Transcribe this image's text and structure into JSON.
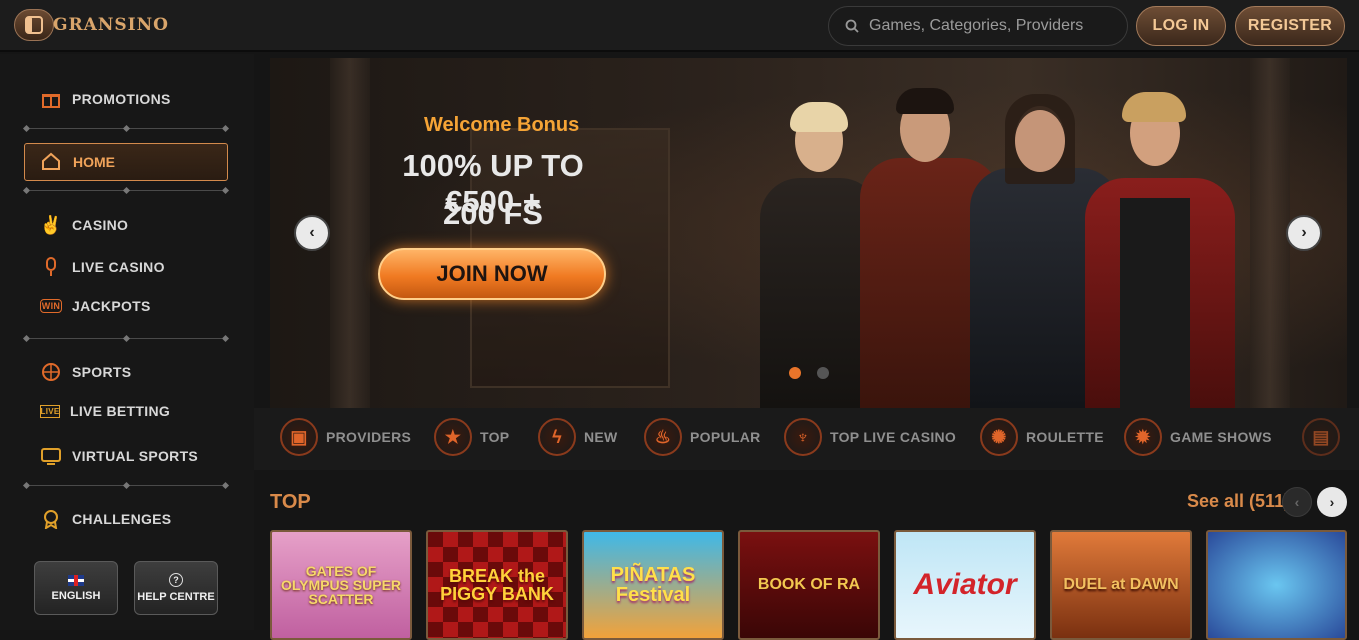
{
  "header": {
    "logo_text": "GRANSINO",
    "search_placeholder": "Games, Categories, Providers",
    "login_label": "LOG IN",
    "register_label": "REGISTER"
  },
  "sidebar": {
    "items": [
      {
        "label": "PROMOTIONS",
        "icon": "gift-icon"
      },
      {
        "label": "HOME",
        "icon": "home-icon"
      },
      {
        "label": "CASINO",
        "icon": "rock-hand-icon"
      },
      {
        "label": "LIVE CASINO",
        "icon": "microphone-icon"
      },
      {
        "label": "JACKPOTS",
        "icon": "jackpot-win-icon"
      },
      {
        "label": "SPORTS",
        "icon": "basketball-icon"
      },
      {
        "label": "LIVE BETTING",
        "icon": "live-badge-icon"
      },
      {
        "label": "VIRTUAL SPORTS",
        "icon": "virtual-screen-icon"
      },
      {
        "label": "CHALLENGES",
        "icon": "medal-icon"
      }
    ],
    "language_label": "ENGLISH",
    "help_label": "HELP CENTRE"
  },
  "hero": {
    "subtitle": "Welcome Bonus",
    "line1": "100% UP TO €500 +",
    "line2": "200 FS",
    "cta": "JOIN NOW",
    "active_slide": 1,
    "slide_count": 2
  },
  "categories": [
    {
      "label": "PROVIDERS",
      "icon": "slot-machine-icon"
    },
    {
      "label": "TOP",
      "icon": "star-icon"
    },
    {
      "label": "NEW",
      "icon": "lightning-icon"
    },
    {
      "label": "POPULAR",
      "icon": "flame-icon"
    },
    {
      "label": "TOP LIVE CASINO",
      "icon": "microphone-icon"
    },
    {
      "label": "ROULETTE",
      "icon": "roulette-icon"
    },
    {
      "label": "GAME SHOWS",
      "icon": "wheel-icon"
    }
  ],
  "top_section": {
    "title": "TOP",
    "see_all": "See all (511)"
  },
  "games": [
    {
      "title": "GATES OF OLYMPUS SUPER SCATTER"
    },
    {
      "title": "BREAK the PIGGY BANK"
    },
    {
      "title": "PIÑATAS Festival"
    },
    {
      "title": "BOOK OF RA"
    },
    {
      "title": "Aviator"
    },
    {
      "title": "DUEL at DAWN"
    },
    {
      "title": ""
    }
  ],
  "colors": {
    "accent": "#e06a2a",
    "gold": "#d98a4a",
    "bg": "#151515"
  }
}
